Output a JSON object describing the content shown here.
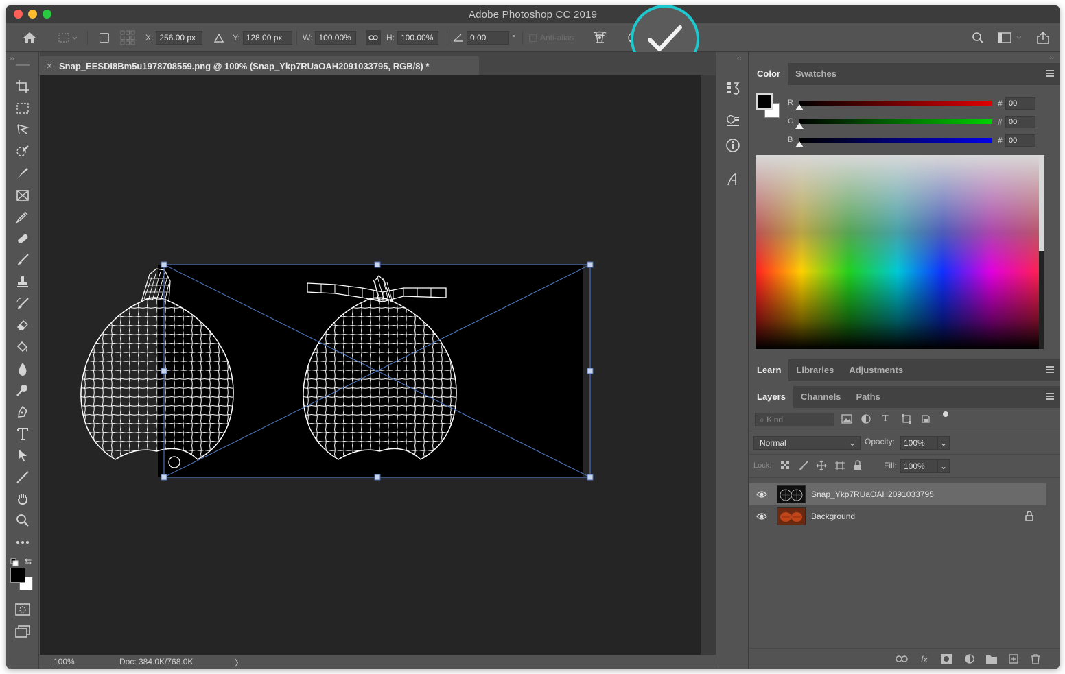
{
  "window": {
    "title": "Adobe Photoshop CC 2019"
  },
  "options": {
    "x_label": "X:",
    "x_value": "256.00 px",
    "y_label": "Y:",
    "y_value": "128.00 px",
    "w_label": "W:",
    "w_value": "100.00%",
    "h_label": "H:",
    "h_value": "100.00%",
    "angle_value": "0.00",
    "degree": "°",
    "antialias_label": "Anti-alias"
  },
  "document": {
    "tab_title": "Snap_EESDI8Bm5u1978708559.png @ 100% (Snap_Ykp7RUaOAH2091033795, RGB/8) *",
    "close_glyph": "×"
  },
  "status": {
    "zoom": "100%",
    "doc_info": "Doc: 384.0K/768.0K",
    "arrow": "〉"
  },
  "color_panel": {
    "tabs": [
      "Color",
      "Swatches"
    ],
    "channels": [
      {
        "label": "R",
        "value": "00",
        "color": "#e00000"
      },
      {
        "label": "G",
        "value": "00",
        "color": "#00d000"
      },
      {
        "label": "B",
        "value": "00",
        "color": "#0000e8"
      }
    ],
    "hash": "#"
  },
  "learn_panel": {
    "tabs": [
      "Learn",
      "Libraries",
      "Adjustments"
    ]
  },
  "layers_panel": {
    "tabs": [
      "Layers",
      "Channels",
      "Paths"
    ],
    "kind_placeholder": "Kind",
    "blend_mode": "Normal",
    "opacity_label": "Opacity:",
    "opacity_value": "100%",
    "lock_label": "Lock:",
    "fill_label": "Fill:",
    "fill_value": "100%",
    "layers": [
      {
        "name": "Snap_Ykp7RUaOAH2091033795",
        "selected": true,
        "locked": false
      },
      {
        "name": "Background",
        "selected": false,
        "locked": true
      }
    ],
    "footer_fx": "fx"
  },
  "colors": {
    "accent_ring": "#1ec8cf",
    "foreground": "#000000",
    "background": "#ffffff",
    "transform_box": "#4a6fb5"
  }
}
